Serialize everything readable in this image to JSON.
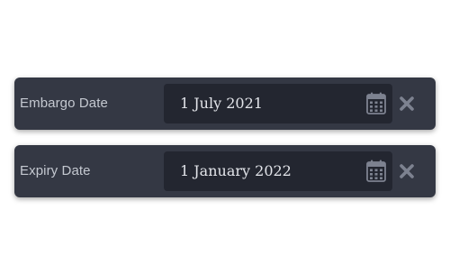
{
  "fields": [
    {
      "label": "Embargo Date",
      "value": "1 July 2021",
      "calendar_icon": "calendar-icon",
      "clear_icon": "clear-x-icon"
    },
    {
      "label": "Expiry Date",
      "value": "1 January 2022",
      "calendar_icon": "calendar-icon",
      "clear_icon": "clear-x-icon"
    }
  ],
  "colors": {
    "row_background": "#343844",
    "input_background": "#232630",
    "label_text": "#c4c8d0",
    "value_text": "#e3e5ea",
    "icon": "#7d8290"
  }
}
